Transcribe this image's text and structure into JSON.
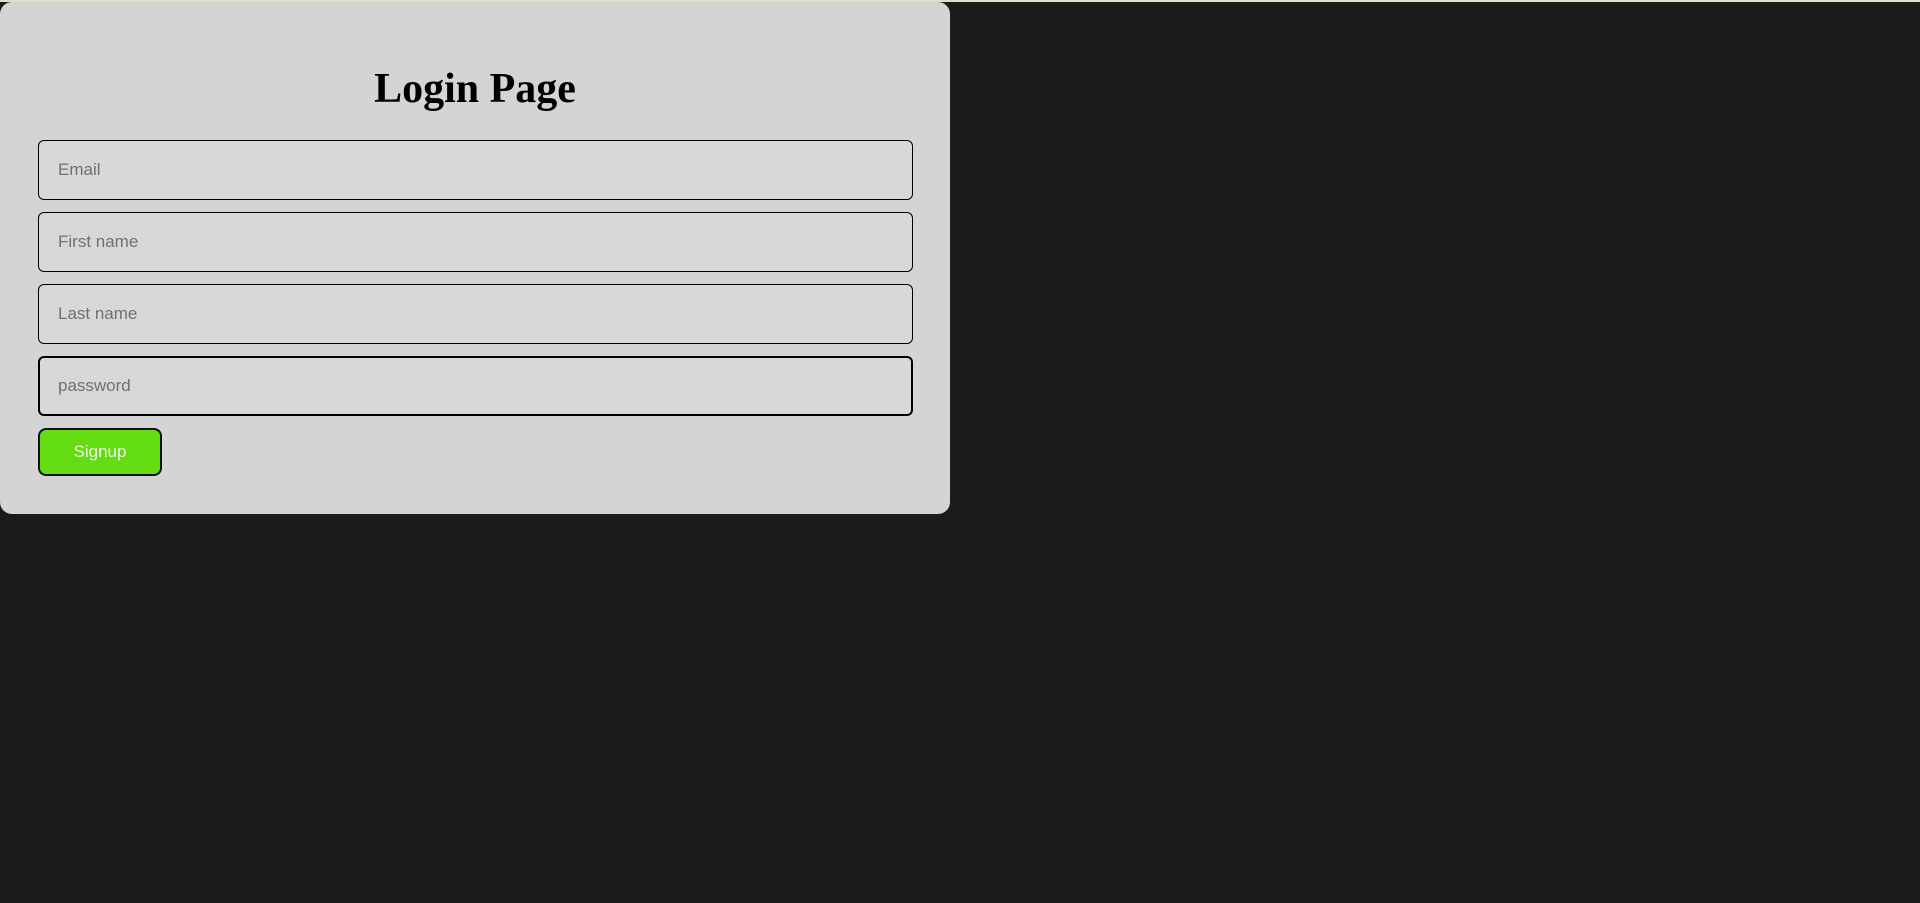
{
  "page": {
    "title": "Login Page"
  },
  "form": {
    "email_placeholder": "Email",
    "first_name_placeholder": "First name",
    "last_name_placeholder": "Last name",
    "password_placeholder": "password",
    "email_value": "",
    "first_name_value": "",
    "last_name_value": "",
    "password_value": "",
    "signup_label": "Signup"
  },
  "colors": {
    "background": "#1b1b1b",
    "card": "#d4d4d4",
    "button": "#63dc13"
  }
}
